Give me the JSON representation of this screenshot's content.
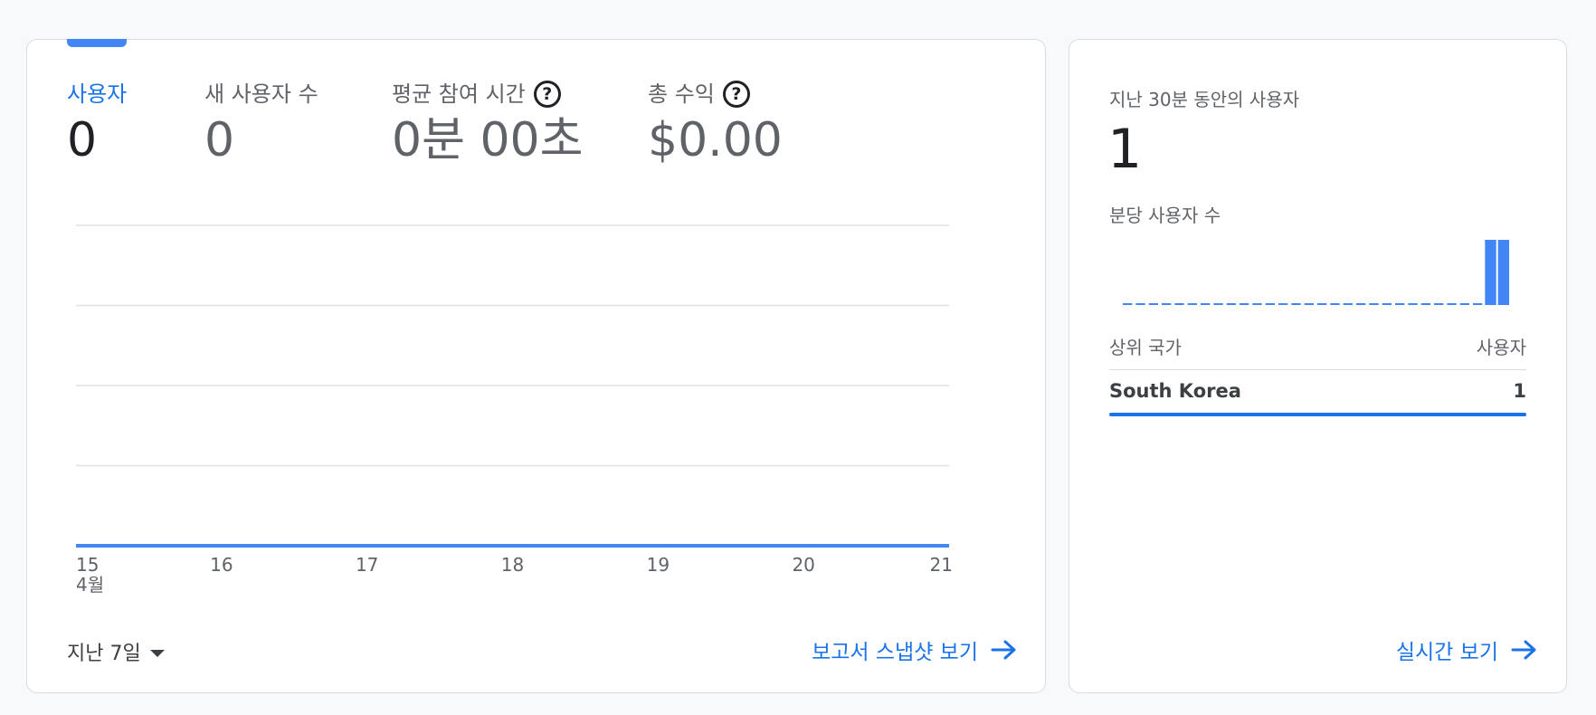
{
  "overview": {
    "metrics": [
      {
        "label": "사용자",
        "value": "0",
        "active": true,
        "help": false
      },
      {
        "label": "새 사용자 수",
        "value": "0",
        "active": false,
        "help": false
      },
      {
        "label": "평균 참여 시간",
        "value": "0분 00초",
        "active": false,
        "help": true
      },
      {
        "label": "총 수익",
        "value": "$0.00",
        "active": false,
        "help": true
      }
    ],
    "date_range": "지난 7일",
    "snapshot_link": "보고서 스냅샷 보기"
  },
  "chart_data": {
    "type": "line",
    "x": [
      "15",
      "16",
      "17",
      "18",
      "19",
      "20",
      "21"
    ],
    "x_sublabel": "4월",
    "series": [
      {
        "values": [
          0,
          0,
          0,
          0,
          0,
          0,
          0
        ]
      }
    ],
    "grid": true,
    "colors": {
      "line": "#4285f4",
      "grid": "#e0e0e0"
    }
  },
  "realtime": {
    "title": "지난 30분 동안의 사용자",
    "value": "1",
    "per_minute_label": "분당 사용자 수",
    "per_minute_values": [
      0,
      0,
      0,
      0,
      0,
      0,
      0,
      0,
      0,
      0,
      0,
      0,
      0,
      0,
      0,
      0,
      0,
      0,
      0,
      0,
      0,
      0,
      0,
      0,
      0,
      0,
      0,
      0,
      1,
      1
    ],
    "table": {
      "col_country": "상위 국가",
      "col_users": "사용자",
      "rows": [
        {
          "country": "South Korea",
          "users": "1"
        }
      ]
    },
    "link": "실시간 보기"
  },
  "colors": {
    "accent": "#1a73e8",
    "chart_blue": "#4285f4"
  }
}
